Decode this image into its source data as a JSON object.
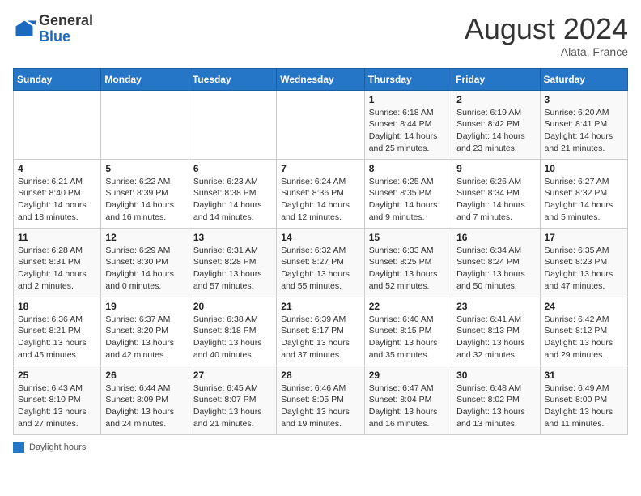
{
  "header": {
    "logo_general": "General",
    "logo_blue": "Blue",
    "month_year": "August 2024",
    "location": "Alata, France"
  },
  "legend": {
    "label": "Daylight hours"
  },
  "days_of_week": [
    "Sunday",
    "Monday",
    "Tuesday",
    "Wednesday",
    "Thursday",
    "Friday",
    "Saturday"
  ],
  "weeks": [
    [
      {
        "day": "",
        "info": ""
      },
      {
        "day": "",
        "info": ""
      },
      {
        "day": "",
        "info": ""
      },
      {
        "day": "",
        "info": ""
      },
      {
        "day": "1",
        "info": "Sunrise: 6:18 AM\nSunset: 8:44 PM\nDaylight: 14 hours and 25 minutes."
      },
      {
        "day": "2",
        "info": "Sunrise: 6:19 AM\nSunset: 8:42 PM\nDaylight: 14 hours and 23 minutes."
      },
      {
        "day": "3",
        "info": "Sunrise: 6:20 AM\nSunset: 8:41 PM\nDaylight: 14 hours and 21 minutes."
      }
    ],
    [
      {
        "day": "4",
        "info": "Sunrise: 6:21 AM\nSunset: 8:40 PM\nDaylight: 14 hours and 18 minutes."
      },
      {
        "day": "5",
        "info": "Sunrise: 6:22 AM\nSunset: 8:39 PM\nDaylight: 14 hours and 16 minutes."
      },
      {
        "day": "6",
        "info": "Sunrise: 6:23 AM\nSunset: 8:38 PM\nDaylight: 14 hours and 14 minutes."
      },
      {
        "day": "7",
        "info": "Sunrise: 6:24 AM\nSunset: 8:36 PM\nDaylight: 14 hours and 12 minutes."
      },
      {
        "day": "8",
        "info": "Sunrise: 6:25 AM\nSunset: 8:35 PM\nDaylight: 14 hours and 9 minutes."
      },
      {
        "day": "9",
        "info": "Sunrise: 6:26 AM\nSunset: 8:34 PM\nDaylight: 14 hours and 7 minutes."
      },
      {
        "day": "10",
        "info": "Sunrise: 6:27 AM\nSunset: 8:32 PM\nDaylight: 14 hours and 5 minutes."
      }
    ],
    [
      {
        "day": "11",
        "info": "Sunrise: 6:28 AM\nSunset: 8:31 PM\nDaylight: 14 hours and 2 minutes."
      },
      {
        "day": "12",
        "info": "Sunrise: 6:29 AM\nSunset: 8:30 PM\nDaylight: 14 hours and 0 minutes."
      },
      {
        "day": "13",
        "info": "Sunrise: 6:31 AM\nSunset: 8:28 PM\nDaylight: 13 hours and 57 minutes."
      },
      {
        "day": "14",
        "info": "Sunrise: 6:32 AM\nSunset: 8:27 PM\nDaylight: 13 hours and 55 minutes."
      },
      {
        "day": "15",
        "info": "Sunrise: 6:33 AM\nSunset: 8:25 PM\nDaylight: 13 hours and 52 minutes."
      },
      {
        "day": "16",
        "info": "Sunrise: 6:34 AM\nSunset: 8:24 PM\nDaylight: 13 hours and 50 minutes."
      },
      {
        "day": "17",
        "info": "Sunrise: 6:35 AM\nSunset: 8:23 PM\nDaylight: 13 hours and 47 minutes."
      }
    ],
    [
      {
        "day": "18",
        "info": "Sunrise: 6:36 AM\nSunset: 8:21 PM\nDaylight: 13 hours and 45 minutes."
      },
      {
        "day": "19",
        "info": "Sunrise: 6:37 AM\nSunset: 8:20 PM\nDaylight: 13 hours and 42 minutes."
      },
      {
        "day": "20",
        "info": "Sunrise: 6:38 AM\nSunset: 8:18 PM\nDaylight: 13 hours and 40 minutes."
      },
      {
        "day": "21",
        "info": "Sunrise: 6:39 AM\nSunset: 8:17 PM\nDaylight: 13 hours and 37 minutes."
      },
      {
        "day": "22",
        "info": "Sunrise: 6:40 AM\nSunset: 8:15 PM\nDaylight: 13 hours and 35 minutes."
      },
      {
        "day": "23",
        "info": "Sunrise: 6:41 AM\nSunset: 8:13 PM\nDaylight: 13 hours and 32 minutes."
      },
      {
        "day": "24",
        "info": "Sunrise: 6:42 AM\nSunset: 8:12 PM\nDaylight: 13 hours and 29 minutes."
      }
    ],
    [
      {
        "day": "25",
        "info": "Sunrise: 6:43 AM\nSunset: 8:10 PM\nDaylight: 13 hours and 27 minutes."
      },
      {
        "day": "26",
        "info": "Sunrise: 6:44 AM\nSunset: 8:09 PM\nDaylight: 13 hours and 24 minutes."
      },
      {
        "day": "27",
        "info": "Sunrise: 6:45 AM\nSunset: 8:07 PM\nDaylight: 13 hours and 21 minutes."
      },
      {
        "day": "28",
        "info": "Sunrise: 6:46 AM\nSunset: 8:05 PM\nDaylight: 13 hours and 19 minutes."
      },
      {
        "day": "29",
        "info": "Sunrise: 6:47 AM\nSunset: 8:04 PM\nDaylight: 13 hours and 16 minutes."
      },
      {
        "day": "30",
        "info": "Sunrise: 6:48 AM\nSunset: 8:02 PM\nDaylight: 13 hours and 13 minutes."
      },
      {
        "day": "31",
        "info": "Sunrise: 6:49 AM\nSunset: 8:00 PM\nDaylight: 13 hours and 11 minutes."
      }
    ]
  ]
}
